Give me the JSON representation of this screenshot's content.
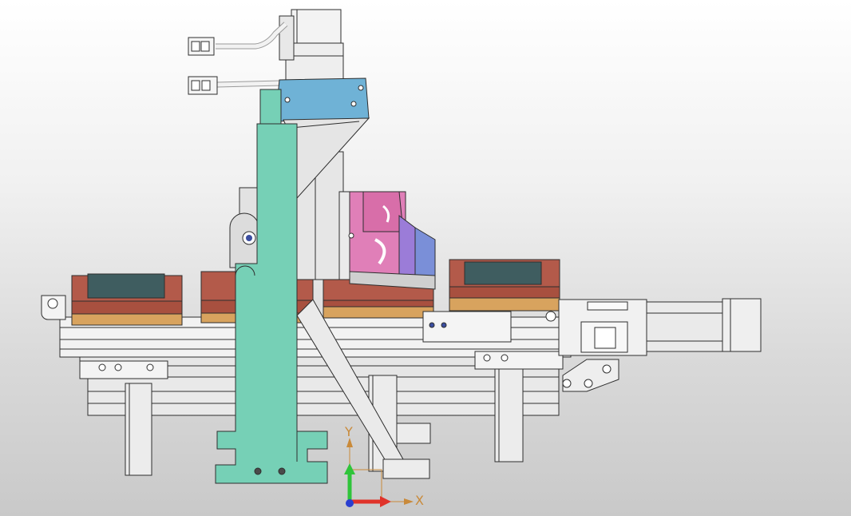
{
  "viewport": {
    "background_top": "#ffffff",
    "background_bottom": "#c9c9c9"
  },
  "triad": {
    "x_label": "X",
    "y_label": "Y",
    "x_color": "#e0332a",
    "y_color": "#2fc43a",
    "z_color": "#2a3fd0",
    "label_color": "#c98a3a"
  },
  "parts": {
    "upright_plate_color": "#76d0b6",
    "motor_mount_color": "#6fb2d6",
    "fixture_color": "#e07fb8",
    "pad_top_color": "#b35a4a",
    "pad_base_color": "#d8a35e",
    "pad_insert_color": "#3f5d60",
    "bracket_color": "#8a5a2e",
    "steel_color": "#eeeeee"
  }
}
